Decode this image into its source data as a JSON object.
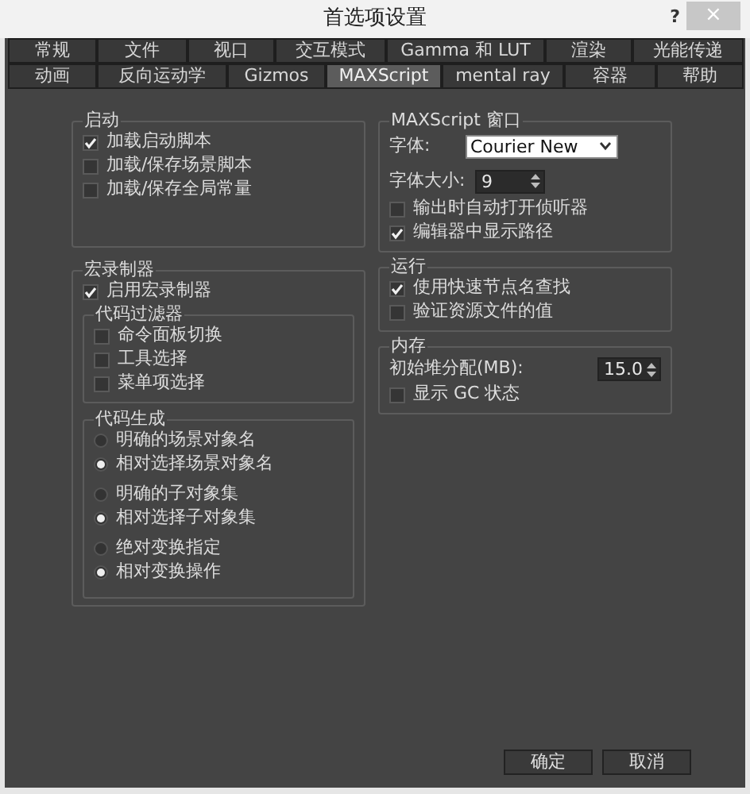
{
  "window": {
    "title": "首选项设置",
    "help": "?",
    "close": "×"
  },
  "tab_rows": [
    [
      {
        "label": "常规",
        "selected": false
      },
      {
        "label": "文件",
        "selected": false
      },
      {
        "label": "视口",
        "selected": false
      },
      {
        "label": "交互模式",
        "selected": false
      },
      {
        "label": "Gamma 和 LUT",
        "selected": false
      },
      {
        "label": "渲染",
        "selected": false
      },
      {
        "label": "光能传递",
        "selected": false
      }
    ],
    [
      {
        "label": "动画",
        "selected": false
      },
      {
        "label": "反向运动学",
        "selected": false
      },
      {
        "label": "Gizmos",
        "selected": false
      },
      {
        "label": "MAXScript",
        "selected": true
      },
      {
        "label": "mental ray",
        "selected": false
      },
      {
        "label": "容器",
        "selected": false
      },
      {
        "label": "帮助",
        "selected": false
      }
    ]
  ],
  "startup": {
    "title": "启动",
    "options": [
      {
        "label": "加载启动脚本",
        "checked": true
      },
      {
        "label": "加载/保存场景脚本",
        "checked": false
      },
      {
        "label": "加载/保存全局常量",
        "checked": false
      }
    ]
  },
  "macro_recorder": {
    "title": "宏录制器",
    "enable": {
      "label": "启用宏录制器",
      "checked": true
    },
    "code_filters": {
      "title": "代码过滤器",
      "options": [
        {
          "label": "命令面板切换",
          "checked": false
        },
        {
          "label": "工具选择",
          "checked": false
        },
        {
          "label": "菜单项选择",
          "checked": false
        }
      ]
    },
    "code_generation": {
      "title": "代码生成",
      "radio_groups": [
        [
          {
            "label": "明确的场景对象名",
            "selected": false
          },
          {
            "label": "相对选择场景对象名",
            "selected": true
          }
        ],
        [
          {
            "label": "明确的子对象集",
            "selected": false
          },
          {
            "label": "相对选择子对象集",
            "selected": true
          }
        ],
        [
          {
            "label": "绝对变换指定",
            "selected": false
          },
          {
            "label": "相对变换操作",
            "selected": true
          }
        ]
      ]
    }
  },
  "maxscript_window": {
    "title": "MAXScript 窗口",
    "font_label": "字体:",
    "font": "Courier New",
    "font_size_label": "字体大小:",
    "font_size": "9",
    "options": [
      {
        "label": "输出时自动打开侦听器",
        "checked": false
      },
      {
        "label": "编辑器中显示路径",
        "checked": true
      }
    ]
  },
  "run": {
    "title": "运行",
    "options": [
      {
        "label": "使用快速节点名查找",
        "checked": true
      },
      {
        "label": "验证资源文件的值",
        "checked": false
      }
    ]
  },
  "memory": {
    "title": "内存",
    "heap_label": "初始堆分配(MB):",
    "heap": "15.0",
    "options": [
      {
        "label": "显示 GC 状态",
        "checked": false
      }
    ]
  },
  "buttons": [
    "确定",
    "取消"
  ]
}
